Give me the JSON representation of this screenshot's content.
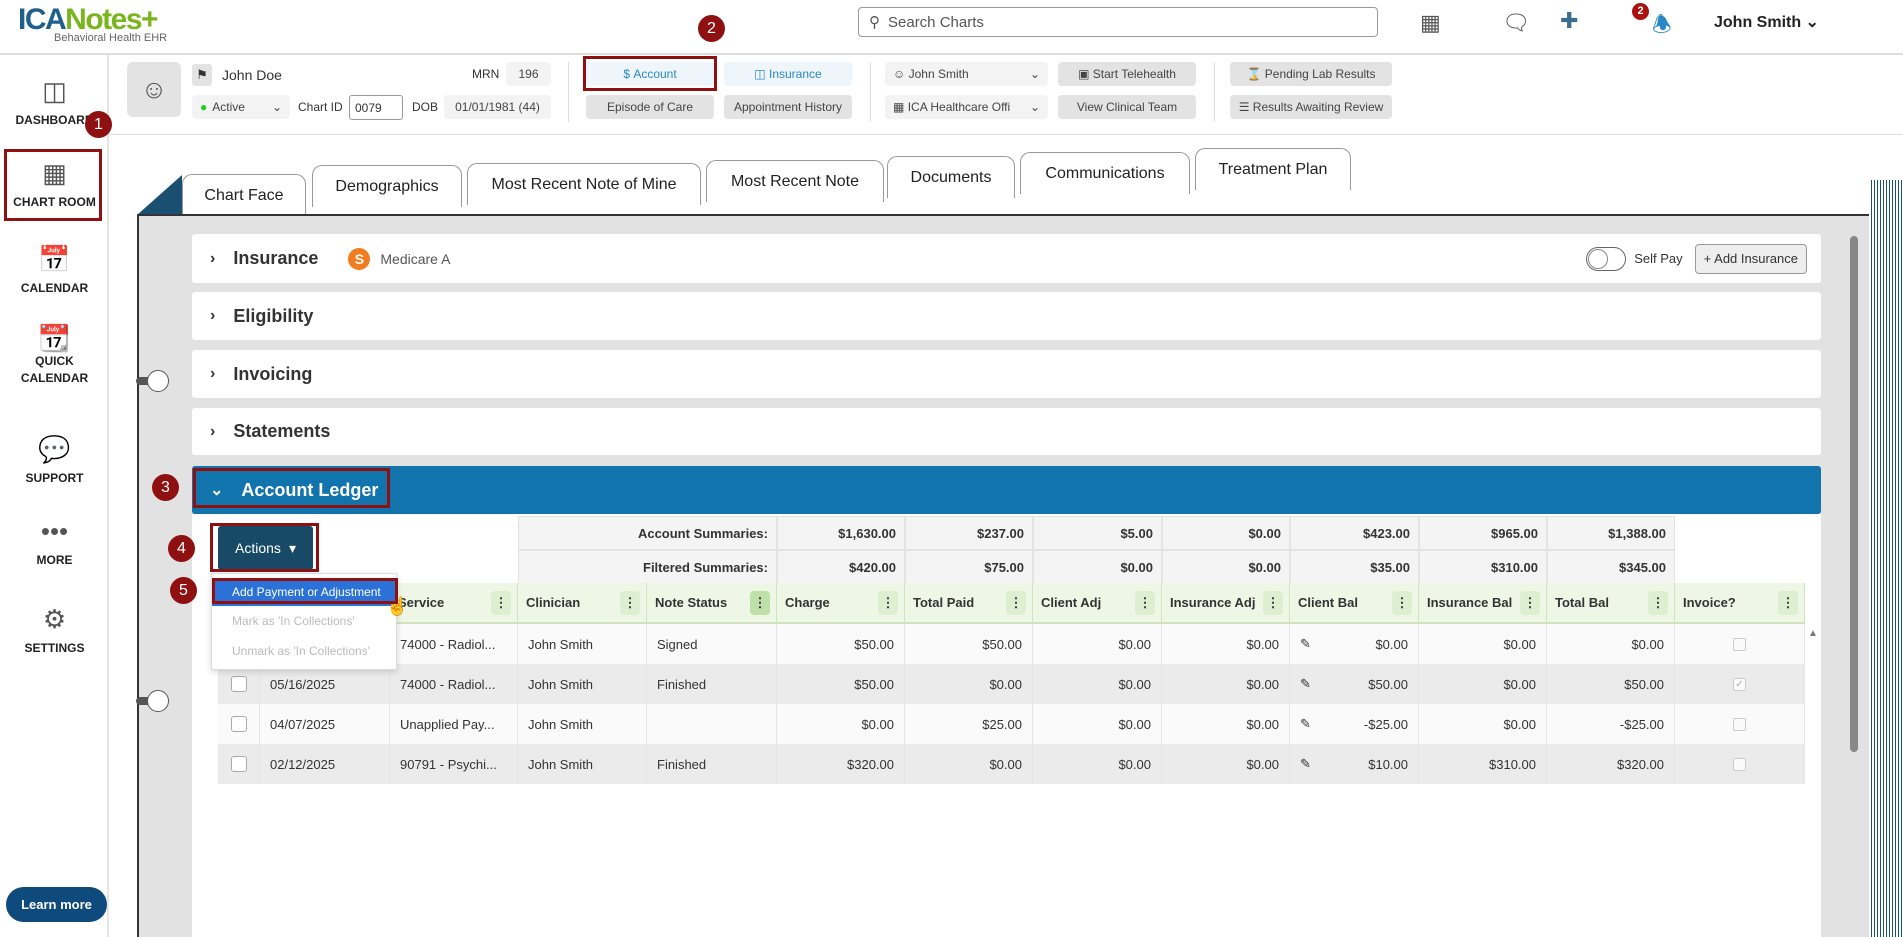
{
  "app": {
    "logo_main": "ICANotes",
    "logo_sub": "Behavioral Health EHR",
    "search_placeholder": "Search Charts",
    "notification_count": "2",
    "user": "John Smith"
  },
  "sidebar": {
    "items": [
      {
        "label": "DASHBOARD",
        "icon": "dashboard-icon"
      },
      {
        "label": "CHART ROOM",
        "icon": "cabinet-icon"
      },
      {
        "label": "CALENDAR",
        "icon": "calendar-icon"
      },
      {
        "label": "QUICK CALENDAR",
        "icon": "quick-calendar-icon"
      },
      {
        "label": "SUPPORT",
        "icon": "chat-icon"
      },
      {
        "label": "MORE",
        "icon": "more-icon"
      },
      {
        "label": "SETTINGS",
        "icon": "gear-icon"
      }
    ],
    "learn_more": "Learn more"
  },
  "patient": {
    "name": "John Doe",
    "status": "Active",
    "mrn_label": "MRN",
    "mrn": "196",
    "chart_id_label": "Chart ID",
    "chart_id": "0079",
    "dob_label": "DOB",
    "dob": "01/01/1981 (44)"
  },
  "header_buttons": {
    "account": "Account",
    "insurance": "Insurance",
    "episode": "Episode of Care",
    "appt_history": "Appointment History",
    "provider": "John Smith",
    "facility": "ICA Healthcare Offi",
    "telehealth": "Start Telehealth",
    "clinical_team": "View Clinical Team",
    "pending_lab": "Pending Lab Results",
    "results_review": "Results Awaiting Review"
  },
  "tabs": [
    "Chart Face",
    "Demographics",
    "Most Recent Note of Mine",
    "Most Recent Note",
    "Documents",
    "Communications",
    "Treatment Plan"
  ],
  "sections": {
    "insurance": "Insurance",
    "insurance_badge": "S",
    "insurance_plan": "Medicare A",
    "self_pay": "Self Pay",
    "add_insurance": "+ Add Insurance",
    "eligibility": "Eligibility",
    "invoicing": "Invoicing",
    "statements": "Statements",
    "ledger": "Account Ledger"
  },
  "ledger": {
    "actions": "Actions",
    "menu": [
      "Add Payment or Adjustment",
      "Mark as 'In Collections'",
      "Unmark as 'In Collections'"
    ],
    "account_label": "Account Summaries:",
    "filtered_label": "Filtered Summaries:",
    "account_summaries": [
      "$1,630.00",
      "$237.00",
      "$5.00",
      "$0.00",
      "$423.00",
      "$965.00",
      "$1,388.00"
    ],
    "filtered_summaries": [
      "$420.00",
      "$75.00",
      "$0.00",
      "$0.00",
      "$35.00",
      "$310.00",
      "$345.00"
    ],
    "columns": [
      "Service",
      "Clinician",
      "Note Status",
      "Charge",
      "Total Paid",
      "Client Adj",
      "Insurance Adj",
      "Client Bal",
      "Insurance Bal",
      "Total Bal",
      "Invoice?"
    ],
    "rows": [
      {
        "date": "",
        "service": "74000 - Radiol...",
        "clinician": "John Smith",
        "status": "Signed",
        "charge": "$50.00",
        "paid": "$50.00",
        "client_adj": "$0.00",
        "ins_adj": "$0.00",
        "client_bal": "$0.00",
        "ins_bal": "$0.00",
        "total_bal": "$0.00",
        "invoice": false
      },
      {
        "date": "05/16/2025",
        "service": "74000 - Radiol...",
        "clinician": "John Smith",
        "status": "Finished",
        "charge": "$50.00",
        "paid": "$0.00",
        "client_adj": "$0.00",
        "ins_adj": "$0.00",
        "client_bal": "$50.00",
        "ins_bal": "$0.00",
        "total_bal": "$50.00",
        "invoice": true
      },
      {
        "date": "04/07/2025",
        "service": "Unapplied Pay...",
        "clinician": "John Smith",
        "status": "",
        "charge": "$0.00",
        "paid": "$25.00",
        "client_adj": "$0.00",
        "ins_adj": "$0.00",
        "client_bal": "-$25.00",
        "ins_bal": "$0.00",
        "total_bal": "-$25.00",
        "invoice": false
      },
      {
        "date": "02/12/2025",
        "service": "90791 - Psychi...",
        "clinician": "John Smith",
        "status": "Finished",
        "charge": "$320.00",
        "paid": "$0.00",
        "client_adj": "$0.00",
        "ins_adj": "$0.00",
        "client_bal": "$10.00",
        "ins_bal": "$310.00",
        "total_bal": "$320.00",
        "invoice": false
      }
    ]
  },
  "annotations": [
    "1",
    "2",
    "3",
    "4",
    "5"
  ],
  "colors": {
    "ledger_header": "#1274ac",
    "actions_button": "#184a68",
    "annotation": "#8f1010",
    "menu_highlight": "#2a72d8",
    "column_header": "#eef7e6"
  }
}
